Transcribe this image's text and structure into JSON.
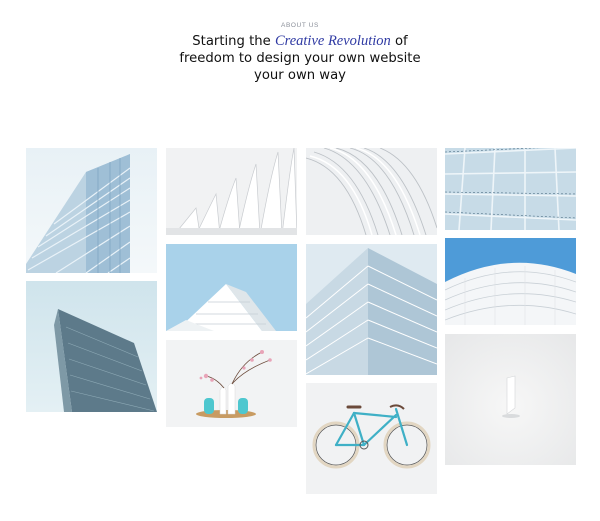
{
  "about": {
    "eyebrow": "ABOUT US",
    "line1_prefix": "Starting the",
    "line1_accent": "Creative Revolution",
    "line1_suffix": "of",
    "line2": "freedom to design your own website",
    "line3": "your own way"
  },
  "colors": {
    "accent": "#2f3aa3",
    "text": "#111111",
    "muted": "#8a8f99",
    "bike_frame": "#3fb0c6"
  },
  "gallery": {
    "images": [
      {
        "subject": "glass-building-facade-icon"
      },
      {
        "subject": "white-fin-roof-structure-icon"
      },
      {
        "subject": "white-ribbed-arch-structure-icon"
      },
      {
        "subject": "glass-panel-grid-icon"
      },
      {
        "subject": "dark-glass-tower-icon"
      },
      {
        "subject": "white-layered-building-icon"
      },
      {
        "subject": "twin-glass-towers-icon"
      },
      {
        "subject": "white-dome-stadium-icon"
      },
      {
        "subject": "vases-with-blossom-icon"
      },
      {
        "subject": "turquoise-bicycle-icon"
      },
      {
        "subject": "white-minimal-object-icon"
      }
    ]
  }
}
